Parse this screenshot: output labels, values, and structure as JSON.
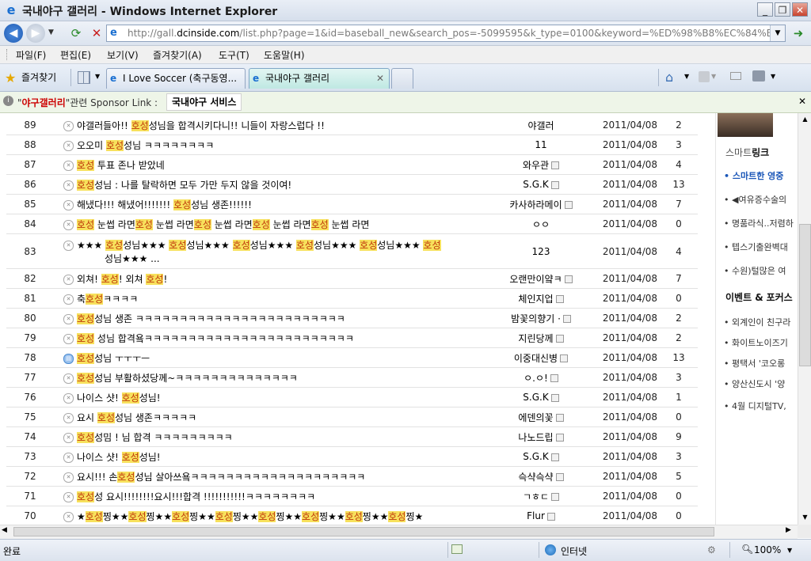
{
  "window": {
    "title": "국내야구 갤러리 - Windows Internet Explorer",
    "min": "_",
    "max": "❐",
    "close": "✕"
  },
  "address": {
    "url_prefix": "http://gall.",
    "url_domain": "dcinside.com",
    "url_suffix": "/list.php?page=1&id=baseball_new&search_pos=-5099595&k_type=0100&keyword=%ED%98%B8%EC%84%B1"
  },
  "menu": [
    "파일(F)",
    "편집(E)",
    "보기(V)",
    "즐겨찾기(A)",
    "도구(T)",
    "도움말(H)"
  ],
  "favorites_label": "즐겨찾기",
  "tabs": [
    {
      "label": "I Love Soccer (축구동영..."
    },
    {
      "label": "국내야구 갤러리"
    }
  ],
  "sponsor": {
    "quote_open": "\"",
    "keyword": "야구갤러리",
    "text": "\"관련 Sponsor Link :",
    "button": "국내야구 서비스",
    "close": "✕"
  },
  "rows": [
    {
      "num": "89",
      "parts": [
        [
          "야갤러들아!! ",
          0
        ],
        [
          "호성",
          1
        ],
        [
          "성님을 합격시키다니!! 니들이 자랑스럽다 !!",
          0
        ]
      ],
      "name": "야갤러",
      "lock": false,
      "date": "2011/04/08",
      "hit": "2"
    },
    {
      "num": "88",
      "parts": [
        [
          "오오미 ",
          0
        ],
        [
          "호성",
          1
        ],
        [
          "성님 ㅋㅋㅋㅋㅋㅋㅋㅋ",
          0
        ]
      ],
      "name": "11",
      "lock": false,
      "date": "2011/04/08",
      "hit": "3"
    },
    {
      "num": "87",
      "parts": [
        [
          "호성",
          1
        ],
        [
          " 투표 존나 받았네",
          0
        ]
      ],
      "name": "와우관",
      "lock": true,
      "date": "2011/04/08",
      "hit": "4"
    },
    {
      "num": "86",
      "parts": [
        [
          "호성",
          1
        ],
        [
          "성님 : 나를 탈락하면 모두 가만 두지 않을 것이여!",
          0
        ]
      ],
      "name": "S.G.K",
      "lock": true,
      "date": "2011/04/08",
      "hit": "13"
    },
    {
      "num": "85",
      "parts": [
        [
          "해냈다!!! 해냈어!!!!!!! ",
          0
        ],
        [
          "호성",
          1
        ],
        [
          "성님 생존!!!!!!",
          0
        ]
      ],
      "name": "카사하라메이",
      "lock": true,
      "date": "2011/04/08",
      "hit": "7"
    },
    {
      "num": "84",
      "parts": [
        [
          "호성",
          1
        ],
        [
          " 눈썹 라면",
          0
        ],
        [
          "호성",
          1
        ],
        [
          " 눈썹 라면",
          0
        ],
        [
          "호성",
          1
        ],
        [
          " 눈썹 라면",
          0
        ],
        [
          "호성",
          1
        ],
        [
          " 눈썹 라면",
          0
        ],
        [
          "호성",
          1
        ],
        [
          " 눈썹 라면",
          0
        ]
      ],
      "name": "ㅇㅇ",
      "lock": false,
      "date": "2011/04/08",
      "hit": "0"
    },
    {
      "num": "83",
      "two": true,
      "parts": [
        [
          "★★★ ",
          0
        ],
        [
          "호성",
          1
        ],
        [
          "성님★★★ ",
          0
        ],
        [
          "호성",
          1
        ],
        [
          "성님★★★ ",
          0
        ],
        [
          "호성",
          1
        ],
        [
          "성님★★★ ",
          0
        ],
        [
          "호성",
          1
        ],
        [
          "성님★★★ ",
          0
        ],
        [
          "호성",
          1
        ],
        [
          "성님★★★ ",
          0
        ],
        [
          "호성",
          1
        ]
      ],
      "line2": "성님★★★ ...",
      "name": "123",
      "lock": false,
      "date": "2011/04/08",
      "hit": "4"
    },
    {
      "num": "82",
      "parts": [
        [
          "외쳐! ",
          0
        ],
        [
          "호성",
          1
        ],
        [
          "! 외쳐 ",
          0
        ],
        [
          "호성",
          1
        ],
        [
          "!",
          0
        ]
      ],
      "name": "오랜만이얔ㅋ",
      "lock": true,
      "date": "2011/04/08",
      "hit": "7"
    },
    {
      "num": "81",
      "parts": [
        [
          "축",
          0
        ],
        [
          "호성",
          1
        ],
        [
          "ㅋㅋㅋㅋ",
          0
        ]
      ],
      "name": "체인지업",
      "lock": true,
      "date": "2011/04/08",
      "hit": "0"
    },
    {
      "num": "80",
      "parts": [
        [
          "호성",
          1
        ],
        [
          "성님 생존 ㅋㅋㅋㅋㅋㅋㅋㅋㅋㅋㅋㅋㅋㅋㅋㅋㅋㅋㅋㅋㅋㅋㅋㅋ",
          0
        ]
      ],
      "name": "밤꽃의향기 ·",
      "lock": true,
      "date": "2011/04/08",
      "hit": "2"
    },
    {
      "num": "79",
      "parts": [
        [
          "호성",
          1
        ],
        [
          " 성님 합격욬ㅋㅋㅋㅋㅋㅋㅋㅋㅋㅋㅋㅋㅋㅋㅋㅋㅋㅋㅋㅋㅋㅋㅋㅋ",
          0
        ]
      ],
      "name": "지린당께",
      "lock": true,
      "date": "2011/04/08",
      "hit": "2"
    },
    {
      "num": "78",
      "pic": true,
      "parts": [
        [
          "호성",
          1
        ],
        [
          "성님 ㅜㅜㅜㅡ",
          0
        ]
      ],
      "name": "이중대신병",
      "lock": true,
      "date": "2011/04/08",
      "hit": "13"
    },
    {
      "num": "77",
      "parts": [
        [
          "호성",
          1
        ],
        [
          "성님 부활하셨당께~ㅋㅋㅋㅋㅋㅋㅋㅋㅋㅋㅋㅋㅋㅋ",
          0
        ]
      ],
      "name": "ㅇ.ㅇ!",
      "lock": true,
      "date": "2011/04/08",
      "hit": "3"
    },
    {
      "num": "76",
      "parts": [
        [
          "나이스 샷! ",
          0
        ],
        [
          "호성",
          1
        ],
        [
          "성님!",
          0
        ]
      ],
      "name": "S.G.K",
      "lock": true,
      "date": "2011/04/08",
      "hit": "1"
    },
    {
      "num": "75",
      "parts": [
        [
          "요시 ",
          0
        ],
        [
          "호성",
          1
        ],
        [
          "성님 생존ㅋㅋㅋㅋㅋ",
          0
        ]
      ],
      "name": "에덴의꽃",
      "lock": true,
      "date": "2011/04/08",
      "hit": "0"
    },
    {
      "num": "74",
      "parts": [
        [
          "호성",
          1
        ],
        [
          "성밈 ! 님 합격 ㅋㅋㅋㅋㅋㅋㅋㅋㅋ",
          0
        ]
      ],
      "name": "나노드립",
      "lock": true,
      "date": "2011/04/08",
      "hit": "9"
    },
    {
      "num": "73",
      "parts": [
        [
          "나이스 샷! ",
          0
        ],
        [
          "호성",
          1
        ],
        [
          "성님!",
          0
        ]
      ],
      "name": "S.G.K",
      "lock": true,
      "date": "2011/04/08",
      "hit": "3"
    },
    {
      "num": "72",
      "parts": [
        [
          "요시!!! 손",
          0
        ],
        [
          "호성",
          1
        ],
        [
          "성님 살아쓰욬ㅋㅋㅋㅋㅋㅋㅋㅋㅋㅋㅋㅋㅋㅋㅋㅋㅋㅋㅋㅋ",
          0
        ]
      ],
      "name": "슥샥슥샥",
      "lock": true,
      "date": "2011/04/08",
      "hit": "5"
    },
    {
      "num": "71",
      "parts": [
        [
          "호성",
          1
        ],
        [
          "성 요시!!!!!!!!요시!!!합격 !!!!!!!!!!!ㅋㅋㅋㅋㅋㅋㅋㅋ",
          0
        ]
      ],
      "name": "ㄱㅎㄷ",
      "lock": true,
      "date": "2011/04/08",
      "hit": "0"
    },
    {
      "num": "70",
      "parts": [
        [
          "★",
          0
        ],
        [
          "호성",
          1
        ],
        [
          "찡★★",
          0
        ],
        [
          "호성",
          1
        ],
        [
          "찡★★",
          0
        ],
        [
          "호성",
          1
        ],
        [
          "찡★★",
          0
        ],
        [
          "호성",
          1
        ],
        [
          "찡★★",
          0
        ],
        [
          "호성",
          1
        ],
        [
          "찡★★",
          0
        ],
        [
          "호성",
          1
        ],
        [
          "찡★★",
          0
        ],
        [
          "호성",
          1
        ],
        [
          "찡★★",
          0
        ],
        [
          "호성",
          1
        ],
        [
          "찡★",
          0
        ]
      ],
      "name": "Flur",
      "lock": true,
      "date": "2011/04/08",
      "hit": "0"
    }
  ],
  "side": {
    "smart_link_head": "스마트",
    "smart_link_bold": "링크",
    "links": [
      "스마트한 영중",
      "◀여유증수술의",
      "명품라식..저렴하",
      "텝스기출완벽대",
      "수원)털많은 여"
    ],
    "event_head": "이벤트 &",
    "event_bold": "포커스",
    "events": [
      "외계인이 친구라",
      "화이트노이즈기",
      "평택서 '코오롱",
      "양산신도시 '양",
      "4월 디지털TV,"
    ]
  },
  "status": {
    "left": "완료",
    "zone": "인터넷",
    "zoom": "100%"
  }
}
